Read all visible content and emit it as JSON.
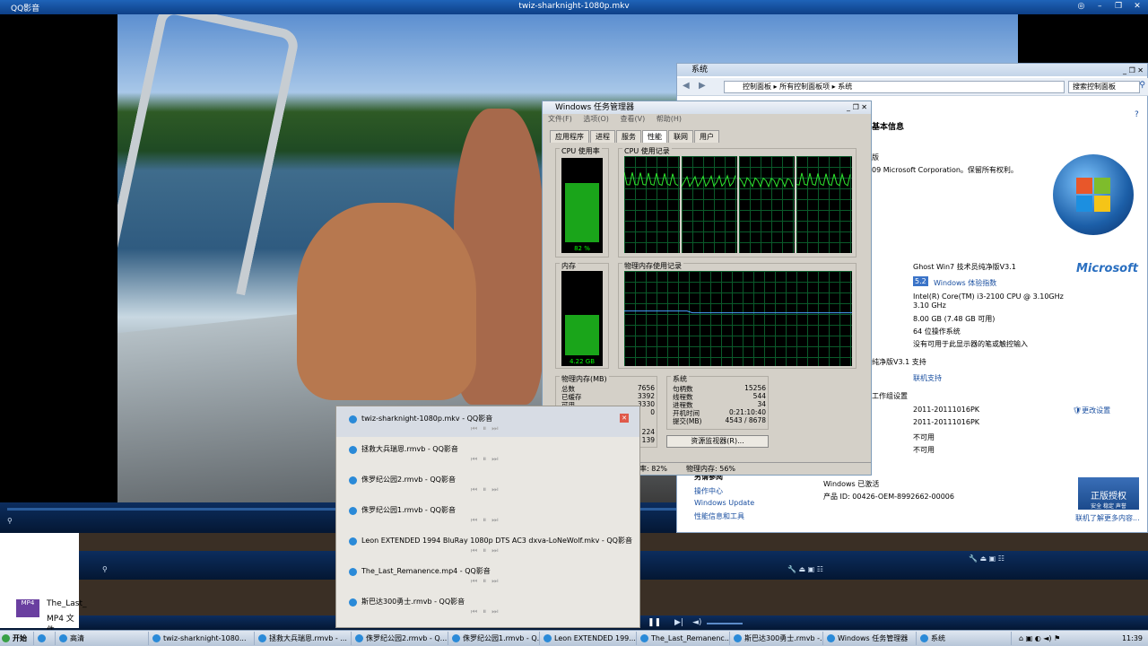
{
  "player": {
    "app_name": "QQ影音",
    "window_title": "twiz-sharknight-1080p.mkv"
  },
  "desktop_file": {
    "icon_label": "MP4",
    "name": "The_Last_",
    "type": "MP4 文件"
  },
  "system_window": {
    "title": "系统",
    "breadcrumb": [
      "控制面板",
      "所有控制面板项",
      "系统"
    ],
    "search_placeholder": "搜索控制面板",
    "heading": "基本信息",
    "edition_line": "版",
    "copyright": "09 Microsoft Corporation。保留所有权利。",
    "oem": "Ghost Win7 技术员纯净版V3.1",
    "rating_score": "5.2",
    "rating_link": "Windows 体验指数",
    "cpu": "Intel(R) Core(TM) i3-2100 CPU @ 3.10GHz",
    "cpu_speed": "3.10 GHz",
    "memory": "8.00 GB (7.48 GB 可用)",
    "system_type": "64 位操作系统",
    "pen_touch": "没有可用于此显示器的笔或触控输入",
    "support_section": "纯净版V3.1 支持",
    "online_support": "联机支持",
    "workgroup_section": "工作组设置",
    "computer_name": "2011-20111016PK",
    "full_name": "2011-20111016PK",
    "description": "不可用",
    "workgroup": "不可用",
    "change_settings": "更改设置",
    "ms_logo": "Microsoft",
    "see_also": "另请参阅",
    "see_also_links": [
      "操作中心",
      "Windows Update",
      "性能信息和工具"
    ],
    "activation": "Windows 已激活",
    "product_id": "产品 ID: 00426-OEM-8992662-00006",
    "genuine_badge": "正版授权",
    "genuine_sub": "安全 稳定 声誉",
    "learn_more": "联机了解更多内容..."
  },
  "task_manager": {
    "title": "Windows 任务管理器",
    "menu": [
      "文件(F)",
      "选项(O)",
      "查看(V)",
      "帮助(H)"
    ],
    "tabs": [
      "应用程序",
      "进程",
      "服务",
      "性能",
      "联网",
      "用户"
    ],
    "active_tab": "性能",
    "cpu_usage_label": "CPU 使用率",
    "cpu_usage_value": "82 %",
    "cpu_usage_fraction": 0.82,
    "cpu_history_label": "CPU 使用记录",
    "memory_label": "内存",
    "memory_value": "4.22 GB",
    "memory_fraction": 0.56,
    "mem_history_label": "物理内存使用记录",
    "phys_mem_header": "物理内存(MB)",
    "phys_mem": [
      {
        "label": "总数",
        "value": "7656"
      },
      {
        "label": "已缓存",
        "value": "3392"
      },
      {
        "label": "可用",
        "value": "3330"
      },
      {
        "label": "空闲",
        "value": "0"
      }
    ],
    "system_header": "系统",
    "system_stats": [
      {
        "label": "句柄数",
        "value": "15256"
      },
      {
        "label": "线程数",
        "value": "544"
      },
      {
        "label": "进程数",
        "value": "34"
      },
      {
        "label": "开机时间",
        "value": "0:21:10:40"
      },
      {
        "label": "提交(MB)",
        "value": "4543 / 8678"
      }
    ],
    "kernel_partial": [
      "224",
      "139"
    ],
    "resmon_button": "资源监视器(R)...",
    "status_cpu": "CPU 使用率: 82%",
    "status_cpu_visible": "率: 82%",
    "status_mem": "物理内存: 56%"
  },
  "thumbnails": [
    {
      "title": "twiz-sharknight-1080p.mkv - QQ影音",
      "selected": true
    },
    {
      "title": "拯救大兵瑞恩.rmvb - QQ影音"
    },
    {
      "title": "侏罗纪公园2.rmvb - QQ影音"
    },
    {
      "title": "侏罗纪公园1.rmvb - QQ影音"
    },
    {
      "title": "Leon EXTENDED 1994 BluRay 1080p DTS AC3 dxva-LoNeWolf.mkv - QQ影音"
    },
    {
      "title": "The_Last_Remanence.mp4 - QQ影音"
    },
    {
      "title": "斯巴达300勇士.rmvb - QQ影音"
    }
  ],
  "taskbar": {
    "start": "开始",
    "items": [
      "高清",
      "twiz-sharknight-1080...",
      "拯救大兵瑞恩.rmvb - ...",
      "侏罗纪公园2.rmvb - Q...",
      "侏罗纪公园1.rmvb - Q...",
      "Leon EXTENDED 199...",
      "The_Last_Remanenc...",
      "斯巴达300勇士.rmvb -...",
      "Windows 任务管理器",
      "系统"
    ],
    "clock": "11:39"
  }
}
